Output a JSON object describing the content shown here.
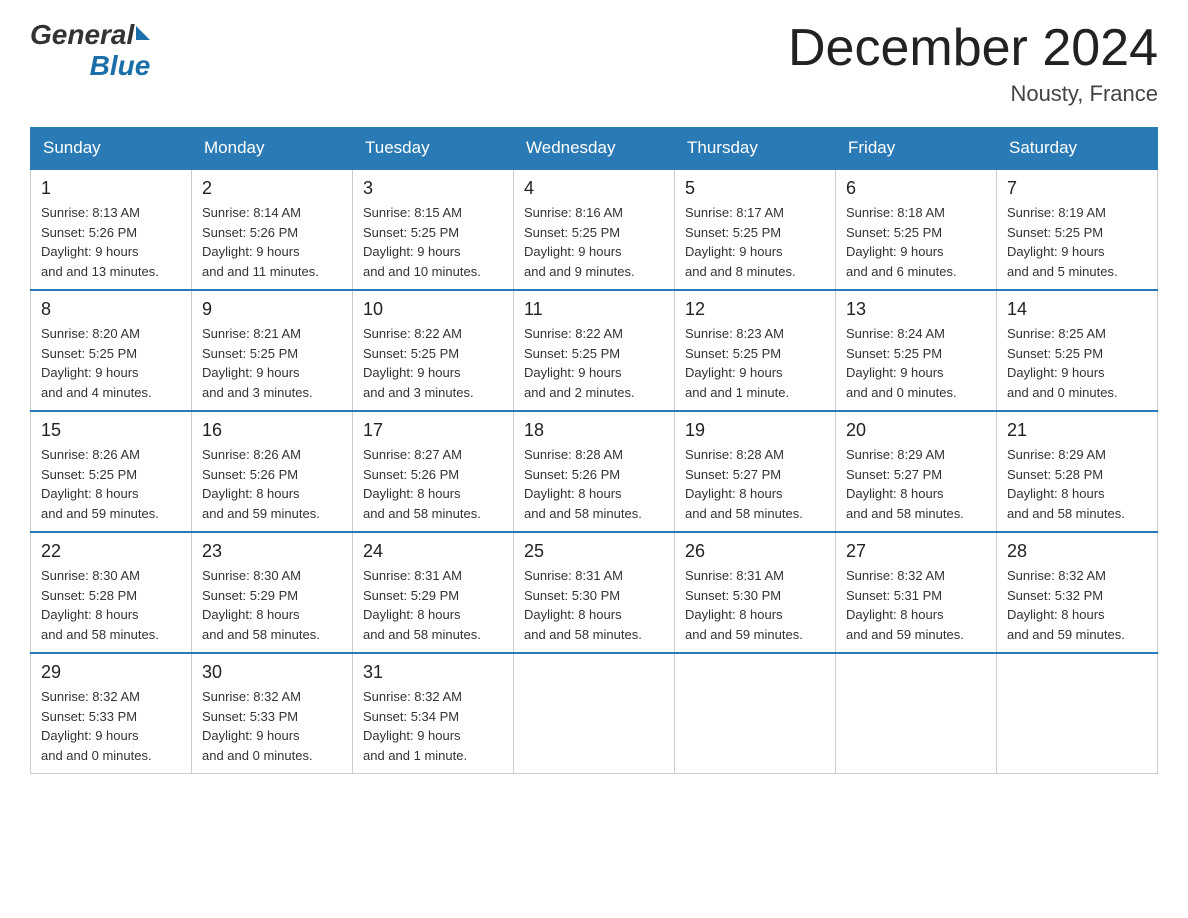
{
  "header": {
    "logo_general": "General",
    "logo_blue": "Blue",
    "title": "December 2024",
    "subtitle": "Nousty, France"
  },
  "days_of_week": [
    "Sunday",
    "Monday",
    "Tuesday",
    "Wednesday",
    "Thursday",
    "Friday",
    "Saturday"
  ],
  "weeks": [
    [
      {
        "num": "1",
        "sunrise": "8:13 AM",
        "sunset": "5:26 PM",
        "daylight": "9 hours and 13 minutes."
      },
      {
        "num": "2",
        "sunrise": "8:14 AM",
        "sunset": "5:26 PM",
        "daylight": "9 hours and 11 minutes."
      },
      {
        "num": "3",
        "sunrise": "8:15 AM",
        "sunset": "5:25 PM",
        "daylight": "9 hours and 10 minutes."
      },
      {
        "num": "4",
        "sunrise": "8:16 AM",
        "sunset": "5:25 PM",
        "daylight": "9 hours and 9 minutes."
      },
      {
        "num": "5",
        "sunrise": "8:17 AM",
        "sunset": "5:25 PM",
        "daylight": "9 hours and 8 minutes."
      },
      {
        "num": "6",
        "sunrise": "8:18 AM",
        "sunset": "5:25 PM",
        "daylight": "9 hours and 6 minutes."
      },
      {
        "num": "7",
        "sunrise": "8:19 AM",
        "sunset": "5:25 PM",
        "daylight": "9 hours and 5 minutes."
      }
    ],
    [
      {
        "num": "8",
        "sunrise": "8:20 AM",
        "sunset": "5:25 PM",
        "daylight": "9 hours and 4 minutes."
      },
      {
        "num": "9",
        "sunrise": "8:21 AM",
        "sunset": "5:25 PM",
        "daylight": "9 hours and 3 minutes."
      },
      {
        "num": "10",
        "sunrise": "8:22 AM",
        "sunset": "5:25 PM",
        "daylight": "9 hours and 3 minutes."
      },
      {
        "num": "11",
        "sunrise": "8:22 AM",
        "sunset": "5:25 PM",
        "daylight": "9 hours and 2 minutes."
      },
      {
        "num": "12",
        "sunrise": "8:23 AM",
        "sunset": "5:25 PM",
        "daylight": "9 hours and 1 minute."
      },
      {
        "num": "13",
        "sunrise": "8:24 AM",
        "sunset": "5:25 PM",
        "daylight": "9 hours and 0 minutes."
      },
      {
        "num": "14",
        "sunrise": "8:25 AM",
        "sunset": "5:25 PM",
        "daylight": "9 hours and 0 minutes."
      }
    ],
    [
      {
        "num": "15",
        "sunrise": "8:26 AM",
        "sunset": "5:25 PM",
        "daylight": "8 hours and 59 minutes."
      },
      {
        "num": "16",
        "sunrise": "8:26 AM",
        "sunset": "5:26 PM",
        "daylight": "8 hours and 59 minutes."
      },
      {
        "num": "17",
        "sunrise": "8:27 AM",
        "sunset": "5:26 PM",
        "daylight": "8 hours and 58 minutes."
      },
      {
        "num": "18",
        "sunrise": "8:28 AM",
        "sunset": "5:26 PM",
        "daylight": "8 hours and 58 minutes."
      },
      {
        "num": "19",
        "sunrise": "8:28 AM",
        "sunset": "5:27 PM",
        "daylight": "8 hours and 58 minutes."
      },
      {
        "num": "20",
        "sunrise": "8:29 AM",
        "sunset": "5:27 PM",
        "daylight": "8 hours and 58 minutes."
      },
      {
        "num": "21",
        "sunrise": "8:29 AM",
        "sunset": "5:28 PM",
        "daylight": "8 hours and 58 minutes."
      }
    ],
    [
      {
        "num": "22",
        "sunrise": "8:30 AM",
        "sunset": "5:28 PM",
        "daylight": "8 hours and 58 minutes."
      },
      {
        "num": "23",
        "sunrise": "8:30 AM",
        "sunset": "5:29 PM",
        "daylight": "8 hours and 58 minutes."
      },
      {
        "num": "24",
        "sunrise": "8:31 AM",
        "sunset": "5:29 PM",
        "daylight": "8 hours and 58 minutes."
      },
      {
        "num": "25",
        "sunrise": "8:31 AM",
        "sunset": "5:30 PM",
        "daylight": "8 hours and 58 minutes."
      },
      {
        "num": "26",
        "sunrise": "8:31 AM",
        "sunset": "5:30 PM",
        "daylight": "8 hours and 59 minutes."
      },
      {
        "num": "27",
        "sunrise": "8:32 AM",
        "sunset": "5:31 PM",
        "daylight": "8 hours and 59 minutes."
      },
      {
        "num": "28",
        "sunrise": "8:32 AM",
        "sunset": "5:32 PM",
        "daylight": "8 hours and 59 minutes."
      }
    ],
    [
      {
        "num": "29",
        "sunrise": "8:32 AM",
        "sunset": "5:33 PM",
        "daylight": "9 hours and 0 minutes."
      },
      {
        "num": "30",
        "sunrise": "8:32 AM",
        "sunset": "5:33 PM",
        "daylight": "9 hours and 0 minutes."
      },
      {
        "num": "31",
        "sunrise": "8:32 AM",
        "sunset": "5:34 PM",
        "daylight": "9 hours and 1 minute."
      },
      null,
      null,
      null,
      null
    ]
  ],
  "labels": {
    "sunrise": "Sunrise:",
    "sunset": "Sunset:",
    "daylight": "Daylight:"
  }
}
